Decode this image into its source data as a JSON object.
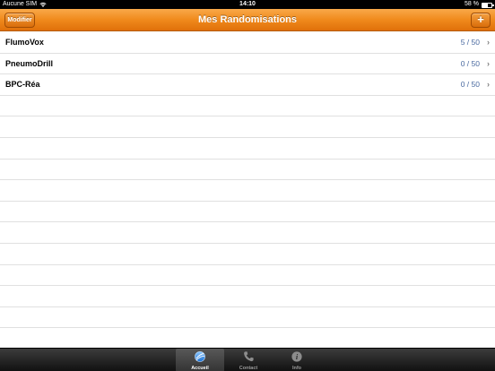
{
  "status_bar": {
    "carrier": "Aucune SIM",
    "time": "14:10",
    "battery": "58 %",
    "wifi_icon": "wifi-icon",
    "battery_icon": "battery-icon"
  },
  "nav_bar": {
    "title": "Mes Randomisations",
    "edit_label": "Modifier",
    "add_label": "+",
    "accent_color": "#f08a1c"
  },
  "table": {
    "rows": [
      {
        "label": "FlumoVox",
        "count": "5 / 50"
      },
      {
        "label": "PneumoDrill",
        "count": "0 / 50"
      },
      {
        "label": "BPC-Réa",
        "count": "0 / 50"
      }
    ],
    "empty_rows": 12,
    "chevron_icon": "chevron-right-icon"
  },
  "tab_bar": {
    "tabs": [
      {
        "label": "Accueil",
        "icon": "home-globe-icon",
        "active": true
      },
      {
        "label": "Contact",
        "icon": "phone-icon",
        "active": false
      },
      {
        "label": "Info",
        "icon": "info-icon",
        "active": false
      }
    ]
  }
}
